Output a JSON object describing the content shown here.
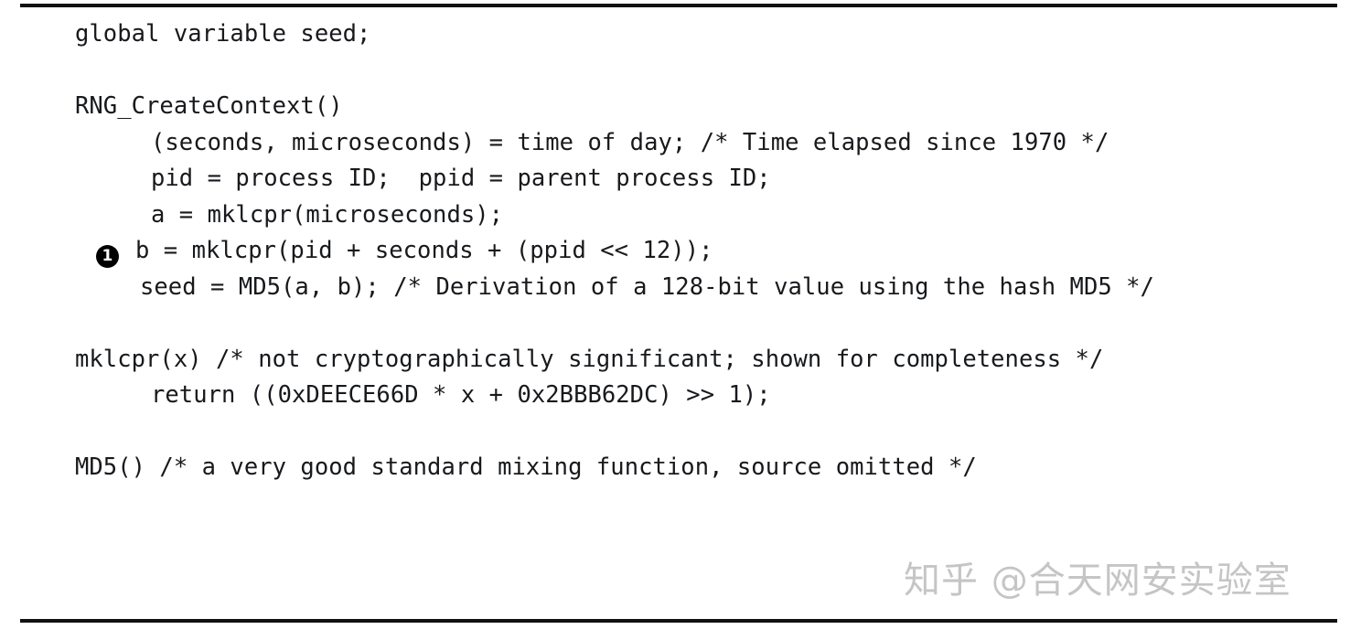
{
  "figure": {
    "name": "rng-pseudocode-listing",
    "top_rule": true,
    "bottom_rule": true,
    "text_color": "#17191c",
    "rule_color": "#111111",
    "background": "#ffffff"
  },
  "code": {
    "lines": [
      {
        "id": "line-1",
        "indent": 60,
        "text": "global variable seed;"
      },
      {
        "id": "line-2",
        "indent": 0,
        "text": "",
        "blank": true
      },
      {
        "id": "line-3",
        "indent": 60,
        "text": "RNG_CreateContext()"
      },
      {
        "id": "line-4",
        "indent": 143,
        "text": "(seconds, microseconds) = time of day; /* Time elapsed since 1970 */"
      },
      {
        "id": "line-5",
        "indent": 143,
        "text": "pid = process ID;  ppid = parent process ID;"
      },
      {
        "id": "line-6",
        "indent": 143,
        "text": "a = mklcpr(microseconds);"
      },
      {
        "id": "line-7",
        "indent": 83,
        "callout": "1",
        "callout_gap": 18,
        "text": "b = mklcpr(pid + seconds + (ppid << 12));"
      },
      {
        "id": "line-8",
        "indent": 131,
        "text": "seed = MD5(a, b); /* Derivation of a 128-bit value using the hash MD5 */"
      },
      {
        "id": "line-9",
        "indent": 0,
        "text": "",
        "blank": true
      },
      {
        "id": "line-10",
        "indent": 60,
        "text": "mklcpr(x) /* not cryptographically significant; shown for completeness */"
      },
      {
        "id": "line-11",
        "indent": 143,
        "text": "return ((0xDEECE66D * x + 0x2BBB62DC) >> 1);"
      },
      {
        "id": "line-12",
        "indent": 0,
        "text": "",
        "blank": true
      },
      {
        "id": "line-13",
        "indent": 60,
        "text": "MD5() /* a very good standard mixing function, source omitted */"
      }
    ]
  },
  "watermark": {
    "text": "知乎 @合天网安实验室",
    "color": "#969696"
  }
}
